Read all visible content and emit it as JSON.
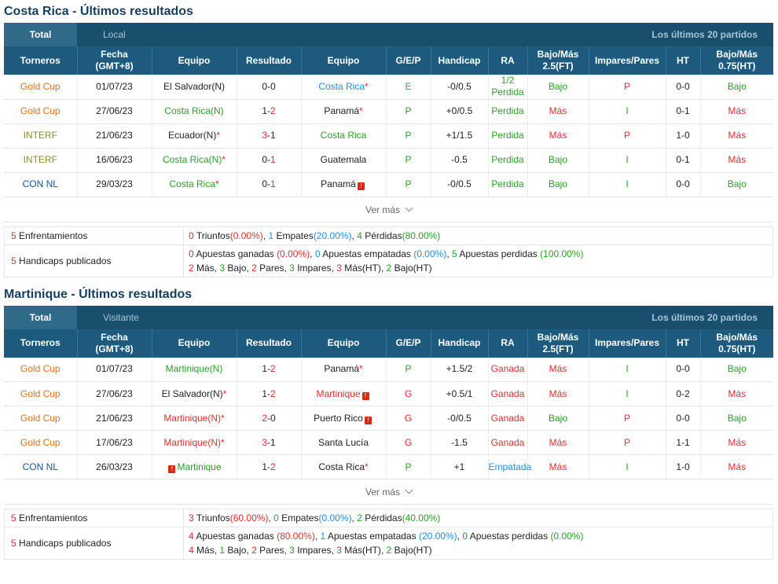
{
  "sections": [
    {
      "title": "Costa Rica - Últimos resultados",
      "tab_total": "Total",
      "tab_side": "Local",
      "tab_last": "Los últimos 20 partidos",
      "headers": [
        "Torneros",
        "Fecha\n(GMT+8)",
        "Equipo",
        "Resultado",
        "Equipo",
        "G/E/P",
        "Handicap",
        "RA",
        "Bajo/Más\n2.5(FT)",
        "Impares/Pares",
        "HT",
        "Bajo/Más\n0.75(HT)"
      ],
      "rows": [
        {
          "league": "Gold Cup",
          "league_color": "c-or",
          "date": "01/07/23",
          "home": "El Salvador(N)",
          "home_color": "blk",
          "home_mark": false,
          "home_star": false,
          "res_a": "0",
          "res_a_color": "blk",
          "res_b": "0",
          "res_b_color": "blk",
          "away": "Costa Rica",
          "away_color": "blue",
          "away_mark": false,
          "away_star": true,
          "gep": "E",
          "gep_color": "blue",
          "hcp": "-0/0.5",
          "ra": "1/2\nPerdida",
          "ra_color": "green",
          "bm": "Bajo",
          "bm_color": "green",
          "ip": "P",
          "ip_color": "red",
          "ht": "0-0",
          "bm2": "Bajo",
          "bm2_color": "green"
        },
        {
          "league": "Gold Cup",
          "league_color": "c-or",
          "date": "27/06/23",
          "home": "Costa Rica(N)",
          "home_color": "green",
          "home_mark": false,
          "home_star": false,
          "res_a": "1",
          "res_a_color": "blk",
          "res_b": "2",
          "res_b_color": "red",
          "away": "Panamá",
          "away_color": "blk",
          "away_mark": false,
          "away_star": true,
          "gep": "P",
          "gep_color": "green",
          "hcp": "+0/0.5",
          "ra": "Perdida",
          "ra_color": "green",
          "bm": "Más",
          "bm_color": "red",
          "ip": "I",
          "ip_color": "green",
          "ht": "0-1",
          "bm2": "Más",
          "bm2_color": "red"
        },
        {
          "league": "INTERF",
          "league_color": "c-ol",
          "date": "21/06/23",
          "home": "Ecuador(N)",
          "home_color": "blk",
          "home_mark": false,
          "home_star": true,
          "res_a": "3",
          "res_a_color": "red",
          "res_b": "1",
          "res_b_color": "blk",
          "away": "Costa Rica",
          "away_color": "green",
          "away_mark": false,
          "away_star": false,
          "gep": "P",
          "gep_color": "green",
          "hcp": "+1/1.5",
          "ra": "Perdida",
          "ra_color": "green",
          "bm": "Más",
          "bm_color": "red",
          "ip": "P",
          "ip_color": "red",
          "ht": "1-0",
          "bm2": "Más",
          "bm2_color": "red"
        },
        {
          "league": "INTERF",
          "league_color": "c-ol",
          "date": "16/06/23",
          "home": "Costa Rica(N)",
          "home_color": "green",
          "home_mark": false,
          "home_star": true,
          "res_a": "0",
          "res_a_color": "blk",
          "res_b": "1",
          "res_b_color": "red",
          "away": "Guatemala",
          "away_color": "blk",
          "away_mark": false,
          "away_star": false,
          "gep": "P",
          "gep_color": "green",
          "hcp": "-0.5",
          "ra": "Perdida",
          "ra_color": "green",
          "bm": "Bajo",
          "bm_color": "green",
          "ip": "I",
          "ip_color": "green",
          "ht": "0-1",
          "bm2": "Más",
          "bm2_color": "red"
        },
        {
          "league": "CON NL",
          "league_color": "c-bl",
          "date": "29/03/23",
          "home": "Costa Rica",
          "home_color": "green",
          "home_mark": false,
          "home_star": true,
          "res_a": "0",
          "res_a_color": "blk",
          "res_b": "1",
          "res_b_color": "red",
          "away": "Panamá",
          "away_color": "blk",
          "away_mark": true,
          "away_star": false,
          "gep": "P",
          "gep_color": "green",
          "hcp": "-0/0.5",
          "ra": "Perdida",
          "ra_color": "green",
          "bm": "Bajo",
          "bm_color": "green",
          "ip": "I",
          "ip_color": "green",
          "ht": "0-0",
          "bm2": "Bajo",
          "bm2_color": "green"
        }
      ],
      "ver_mas": "Ver más",
      "enf_label_n": "5",
      "enf_label": "Enfrentamientos",
      "enf": [
        {
          "n": "0",
          "c": "n-red",
          "t": "Triunfos",
          "p": "(0.00%)",
          "sep": ", "
        },
        {
          "n": "1",
          "c": "n-blue",
          "t": "Empates",
          "p": "(20.00%)",
          "sep": ", "
        },
        {
          "n": "4",
          "c": "n-green",
          "t": "Pérdidas",
          "p": "(80.00%)",
          "sep": ""
        }
      ],
      "hcp_label_n": "5",
      "hcp_label": "Handicaps publicados",
      "hcp1": [
        {
          "n": "0",
          "c": "n-red",
          "t": "Apuestas ganadas",
          "p": "(0.00%)",
          "sep": ", "
        },
        {
          "n": "0",
          "c": "n-blue",
          "t": "Apuestas empatadas",
          "p": "(0.00%)",
          "sep": ", "
        },
        {
          "n": "5",
          "c": "n-green",
          "t": "Apuestas perdidas",
          "p": "(100.00%)",
          "sep": ""
        }
      ],
      "hcp2": [
        {
          "n": "2",
          "c": "n-red",
          "t": "Más",
          "sep": ", "
        },
        {
          "n": "3",
          "c": "n-green",
          "t": "Bajo",
          "sep": ", "
        },
        {
          "n": "2",
          "c": "n-red",
          "t": "Pares",
          "sep": ", "
        },
        {
          "n": "3",
          "c": "n-green",
          "t": "Impares",
          "sep": ", "
        },
        {
          "n": "3",
          "c": "n-red",
          "t": "Más(HT)",
          "sep": ", "
        },
        {
          "n": "2",
          "c": "n-green",
          "t": "Bajo(HT)",
          "sep": ""
        }
      ]
    },
    {
      "title": "Martinique - Últimos resultados",
      "tab_total": "Total",
      "tab_side": "Visitante",
      "tab_last": "Los últimos 20 partidos",
      "headers": [
        "Torneros",
        "Fecha\n(GMT+8)",
        "Equipo",
        "Resultado",
        "Equipo",
        "G/E/P",
        "Handicap",
        "RA",
        "Bajo/Más\n2.5(FT)",
        "Impares/Pares",
        "HT",
        "Bajo/Más\n0.75(HT)"
      ],
      "rows": [
        {
          "league": "Gold Cup",
          "league_color": "c-or",
          "date": "01/07/23",
          "home": "Martinique(N)",
          "home_color": "green",
          "home_mark": false,
          "home_star": false,
          "res_a": "1",
          "res_a_color": "blk",
          "res_b": "2",
          "res_b_color": "red",
          "away": "Panamá",
          "away_color": "blk",
          "away_mark": false,
          "away_star": true,
          "gep": "P",
          "gep_color": "green",
          "hcp": "+1.5/2",
          "ra": "Ganada",
          "ra_color": "red",
          "bm": "Más",
          "bm_color": "red",
          "ip": "I",
          "ip_color": "green",
          "ht": "0-0",
          "bm2": "Bajo",
          "bm2_color": "green"
        },
        {
          "league": "Gold Cup",
          "league_color": "c-or",
          "date": "27/06/23",
          "home": "El Salvador(N)",
          "home_color": "blk",
          "home_mark": false,
          "home_star": true,
          "res_a": "1",
          "res_a_color": "blk",
          "res_b": "2",
          "res_b_color": "red",
          "away": "Martinique",
          "away_color": "red",
          "away_mark": true,
          "away_star": false,
          "gep": "G",
          "gep_color": "red",
          "hcp": "+0.5/1",
          "ra": "Ganada",
          "ra_color": "red",
          "bm": "Más",
          "bm_color": "red",
          "ip": "I",
          "ip_color": "green",
          "ht": "0-2",
          "bm2": "Más",
          "bm2_color": "red"
        },
        {
          "league": "Gold Cup",
          "league_color": "c-or",
          "date": "21/06/23",
          "home": "Martinique(N)",
          "home_color": "red",
          "home_mark": false,
          "home_star": true,
          "res_a": "2",
          "res_a_color": "red",
          "res_b": "0",
          "res_b_color": "blk",
          "away": "Puerto Rico",
          "away_color": "blk",
          "away_mark": true,
          "away_star": false,
          "gep": "G",
          "gep_color": "red",
          "hcp": "-0/0.5",
          "ra": "Ganada",
          "ra_color": "red",
          "bm": "Bajo",
          "bm_color": "green",
          "ip": "P",
          "ip_color": "red",
          "ht": "0-0",
          "bm2": "Bajo",
          "bm2_color": "green"
        },
        {
          "league": "Gold Cup",
          "league_color": "c-or",
          "date": "17/06/23",
          "home": "Martinique(N)",
          "home_color": "red",
          "home_mark": false,
          "home_star": true,
          "res_a": "3",
          "res_a_color": "red",
          "res_b": "1",
          "res_b_color": "blk",
          "away": "Santa Lucía",
          "away_color": "blk",
          "away_mark": false,
          "away_star": false,
          "gep": "G",
          "gep_color": "red",
          "hcp": "-1.5",
          "ra": "Ganada",
          "ra_color": "red",
          "bm": "Más",
          "bm_color": "red",
          "ip": "P",
          "ip_color": "red",
          "ht": "1-1",
          "bm2": "Más",
          "bm2_color": "red"
        },
        {
          "league": "CON NL",
          "league_color": "c-bl",
          "date": "26/03/23",
          "home": "Martinique",
          "home_color": "green",
          "home_mark": "pre",
          "home_star": false,
          "res_a": "1",
          "res_a_color": "blk",
          "res_b": "2",
          "res_b_color": "red",
          "away": "Costa Rica",
          "away_color": "blk",
          "away_mark": false,
          "away_star": true,
          "gep": "P",
          "gep_color": "green",
          "hcp": "+1",
          "ra": "Empatada",
          "ra_color": "blue",
          "bm": "Más",
          "bm_color": "red",
          "ip": "I",
          "ip_color": "green",
          "ht": "1-0",
          "bm2": "Más",
          "bm2_color": "red"
        }
      ],
      "ver_mas": "Ver más",
      "enf_label_n": "5",
      "enf_label": "Enfrentamientos",
      "enf": [
        {
          "n": "3",
          "c": "n-red",
          "t": "Triunfos",
          "p": "(60.00%)",
          "sep": ", "
        },
        {
          "n": "0",
          "c": "n-blue",
          "t": "Empates",
          "p": "(0.00%)",
          "sep": ", "
        },
        {
          "n": "2",
          "c": "n-green",
          "t": "Pérdidas",
          "p": "(40.00%)",
          "sep": ""
        }
      ],
      "hcp_label_n": "5",
      "hcp_label": "Handicaps publicados",
      "hcp1": [
        {
          "n": "4",
          "c": "n-red",
          "t": "Apuestas ganadas",
          "p": "(80.00%)",
          "sep": ", "
        },
        {
          "n": "1",
          "c": "n-blue",
          "t": "Apuestas empatadas",
          "p": "(20.00%)",
          "sep": ", "
        },
        {
          "n": "0",
          "c": "n-green",
          "t": "Apuestas perdidas",
          "p": "(0.00%)",
          "sep": ""
        }
      ],
      "hcp2": [
        {
          "n": "4",
          "c": "n-red",
          "t": "Más",
          "sep": ", "
        },
        {
          "n": "1",
          "c": "n-green",
          "t": "Bajo",
          "sep": ", "
        },
        {
          "n": "2",
          "c": "n-red",
          "t": "Pares",
          "sep": ", "
        },
        {
          "n": "3",
          "c": "n-green",
          "t": "Impares",
          "sep": ", "
        },
        {
          "n": "3",
          "c": "n-red",
          "t": "Más(HT)",
          "sep": ", "
        },
        {
          "n": "2",
          "c": "n-green",
          "t": "Bajo(HT)",
          "sep": ""
        }
      ]
    }
  ],
  "mark_glyph": "!",
  "star_glyph": "*",
  "icons": {
    "warning": "red-square-warning-icon",
    "chevron": "chevron-down-icon"
  }
}
